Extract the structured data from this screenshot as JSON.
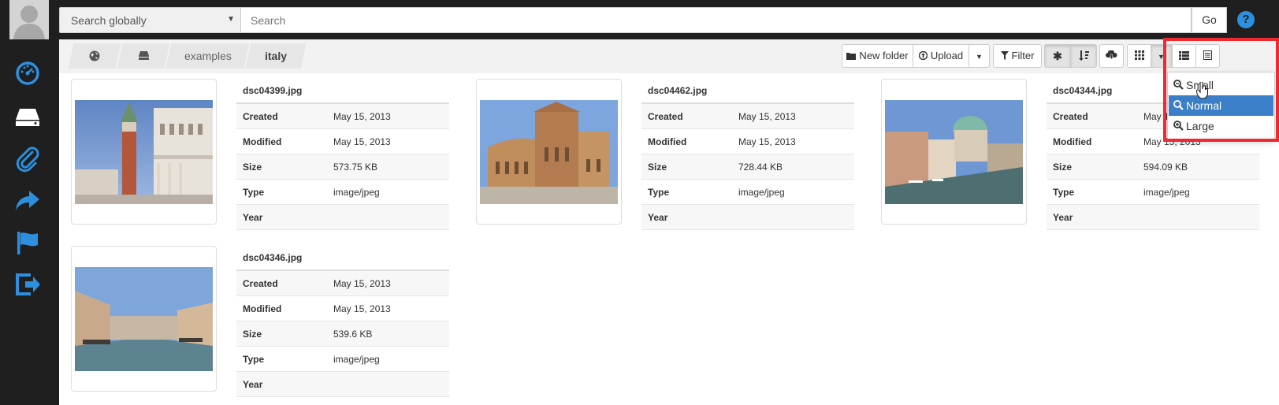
{
  "topbar": {
    "search_scope": "Search globally",
    "search_placeholder": "Search",
    "go_label": "Go",
    "help_label": "?"
  },
  "breadcrumb": [
    "examples",
    "italy"
  ],
  "toolbar": {
    "new_folder": "New folder",
    "upload": "Upload",
    "filter": "Filter"
  },
  "view_dropdown": {
    "items": [
      "Small",
      "Normal",
      "Large"
    ],
    "selected": "Normal"
  },
  "files": [
    {
      "name": "dsc04399.jpg",
      "created": "May 15, 2013",
      "modified": "May 15, 2013",
      "size": "573.75 KB",
      "type": "image/jpeg",
      "year": ""
    },
    {
      "name": "dsc04462.jpg",
      "created": "May 15, 2013",
      "modified": "May 15, 2013",
      "size": "728.44 KB",
      "type": "image/jpeg",
      "year": ""
    },
    {
      "name": "dsc04344.jpg",
      "created": "May 15, 2013",
      "modified": "May 15, 2013",
      "size": "594.09 KB",
      "type": "image/jpeg",
      "year": ""
    },
    {
      "name": "dsc04346.jpg",
      "created": "May 15, 2013",
      "modified": "May 15, 2013",
      "size": "539.6 KB",
      "type": "image/jpeg",
      "year": ""
    }
  ],
  "labels": {
    "created": "Created",
    "modified": "Modified",
    "size": "Size",
    "type": "Type",
    "year": "Year"
  },
  "colors": {
    "dark_bg": "#1f1f1f",
    "accent_blue": "#2d8fdd",
    "selected_blue": "#3a7fc8",
    "highlight_red": "#ee2a30"
  }
}
